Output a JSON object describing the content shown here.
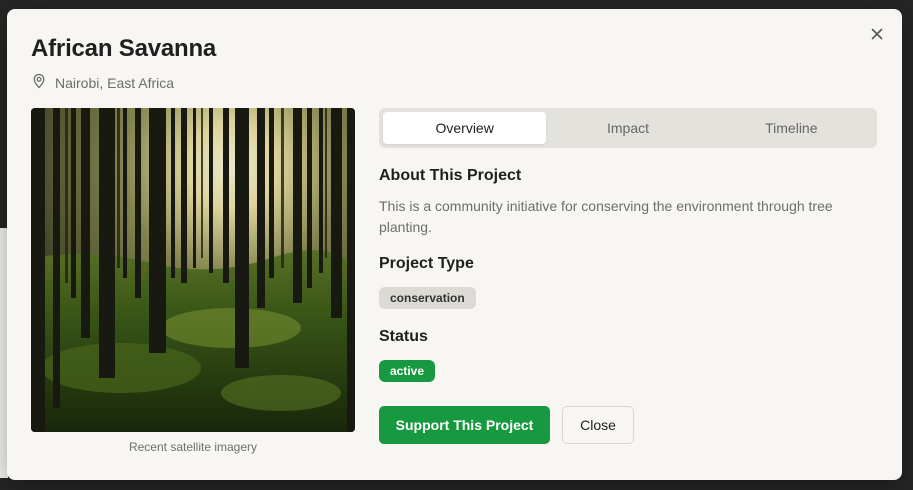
{
  "modal": {
    "title": "African Savanna",
    "location": "Nairobi, East Africa",
    "image_caption": "Recent satellite imagery",
    "tabs": [
      {
        "label": "Overview",
        "active": true
      },
      {
        "label": "Impact",
        "active": false
      },
      {
        "label": "Timeline",
        "active": false
      }
    ],
    "about": {
      "heading": "About This Project",
      "text": "This is a community initiative for conserving the environment through tree planting."
    },
    "project_type": {
      "heading": "Project Type",
      "value": "conservation"
    },
    "status": {
      "heading": "Status",
      "value": "active"
    },
    "actions": {
      "support_label": "Support This Project",
      "close_label": "Close"
    },
    "icons": {
      "close": "close-icon",
      "location": "map-pin-icon"
    }
  },
  "colors": {
    "accent_green": "#179a3f",
    "modal_bg": "#f7f6f2",
    "tab_bar_bg": "#e4e2dd"
  }
}
